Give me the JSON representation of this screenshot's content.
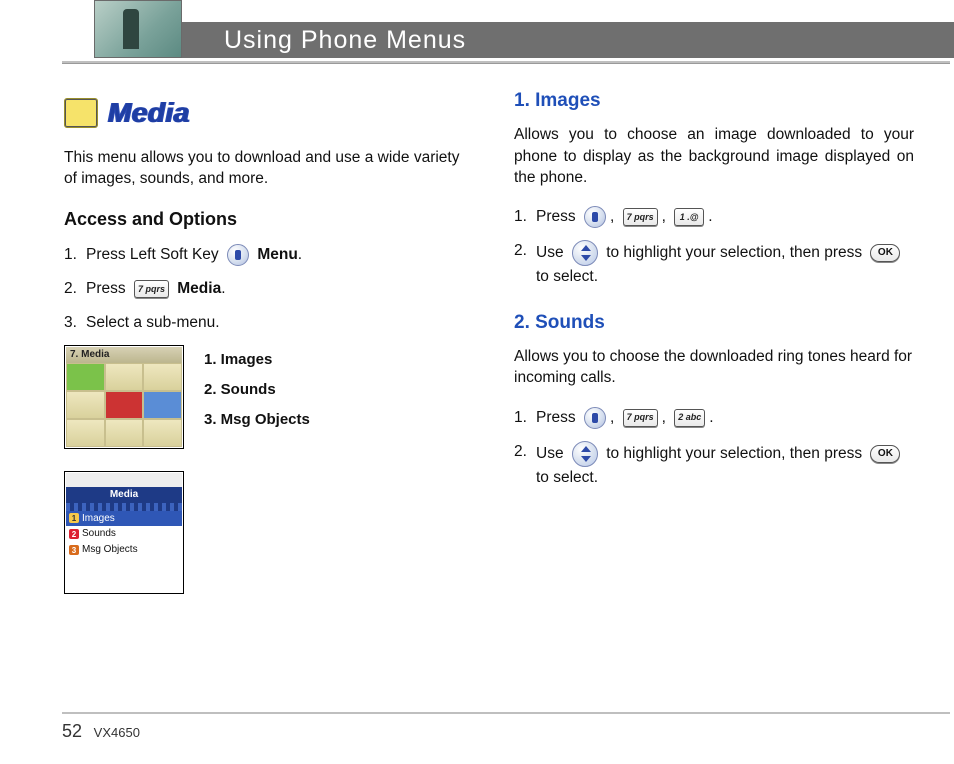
{
  "header": {
    "title": "Using Phone Menus"
  },
  "media": {
    "heading": "Media",
    "intro": "This menu allows you to download and use a wide variety of images, sounds, and more."
  },
  "access": {
    "heading": "Access and Options",
    "step1_a": "Press Left Soft Key",
    "step1_b": "Menu",
    "step2_a": "Press",
    "step2_b": "Media",
    "step3": "Select a sub-menu.",
    "submenu": {
      "i1": "1. Images",
      "i2": "2. Sounds",
      "i3": "3. Msg Objects"
    }
  },
  "screenshot1": {
    "title": "7. Media"
  },
  "screenshot2": {
    "title": "Media",
    "r1": "Images",
    "r2": "Sounds",
    "r3": "Msg Objects"
  },
  "keys": {
    "k7": "7 pqrs",
    "k1": "1 .@",
    "k2": "2 abc",
    "ok": "OK"
  },
  "images_section": {
    "heading": "1. Images",
    "intro": "Allows you to choose an image downloaded to your phone to display as the background image displayed on the phone.",
    "s1": "Press",
    "s2a": "Use",
    "s2b": "to highlight your selection, then press",
    "s2c": "to select."
  },
  "sounds_section": {
    "heading": "2. Sounds",
    "intro": "Allows you to choose the downloaded ring tones heard for incoming calls.",
    "s1": "Press",
    "s2a": "Use",
    "s2b": "to highlight your selection, then press",
    "s2c": "to select."
  },
  "footer": {
    "page": "52",
    "model": "VX4650"
  }
}
